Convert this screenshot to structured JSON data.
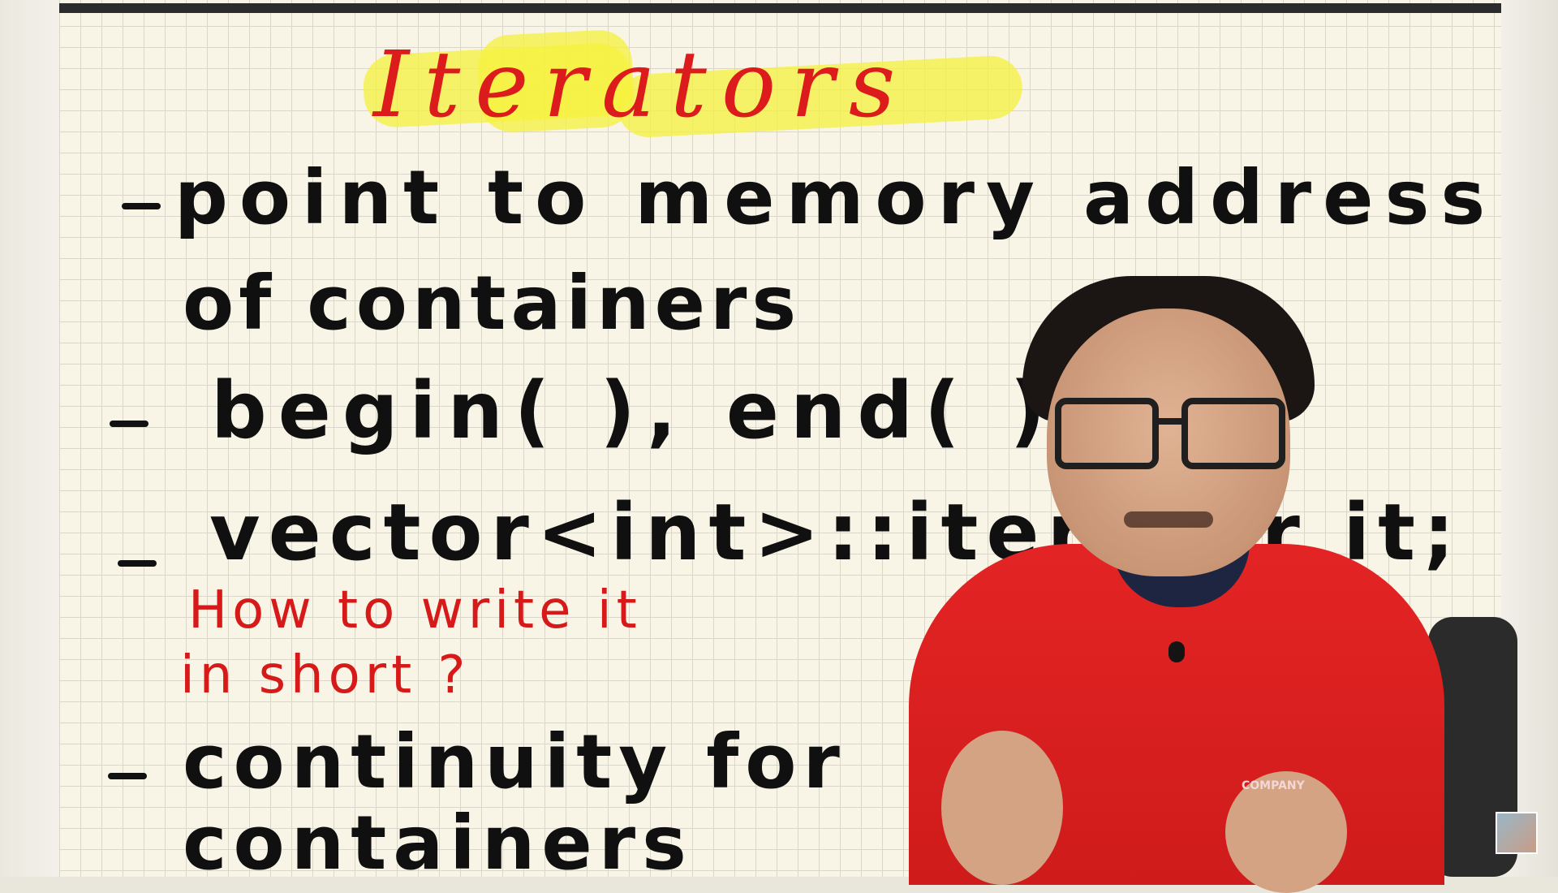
{
  "title": "Iterators",
  "points": [
    {
      "line1": "point to memory address",
      "line2": "of containers"
    },
    {
      "line1": "begin( ), end( )"
    },
    {
      "line1": "vector<int>::iterator it;"
    },
    {
      "line1": "continuity for",
      "line2": "containers"
    }
  ],
  "note": {
    "line1": "How to write it",
    "line2": "in short ?"
  },
  "presenter": {
    "shirt_logo": "COMPANY"
  },
  "colors": {
    "title": "#dc1c1c",
    "highlight": "#f5f23c",
    "ink": "#101010",
    "note": "#d61a1a",
    "shirt": "#e42424"
  }
}
